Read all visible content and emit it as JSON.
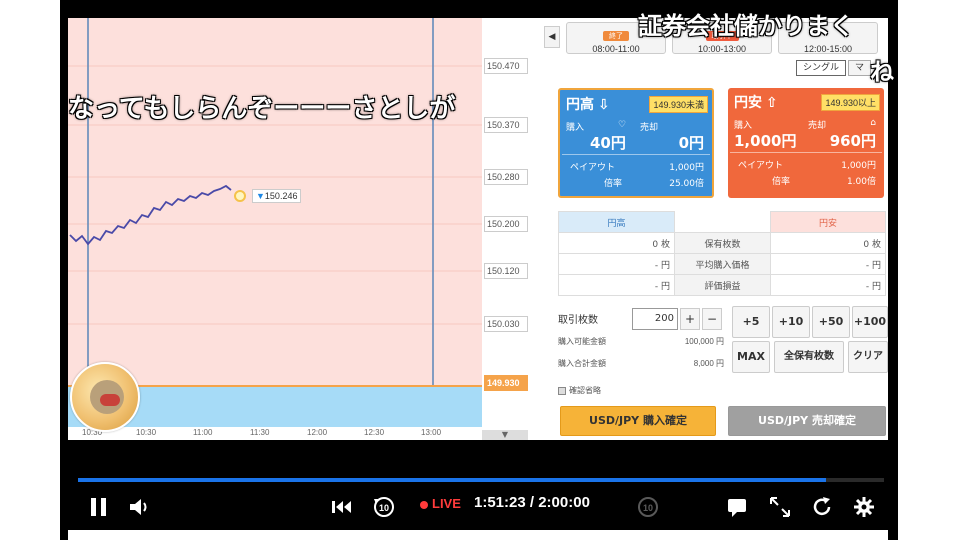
{
  "chart": {
    "y_ticks": [
      "150.470",
      "150.370",
      "150.280",
      "150.200",
      "150.120",
      "150.030"
    ],
    "current_price": "149.930",
    "price_tag": "150.246",
    "x_ticks": [
      "10:30",
      "10:30",
      "11:00",
      "11:30",
      "12:00",
      "12:30",
      "13:00"
    ],
    "line_color": "#4a4aa8",
    "zone_color_up": "#fde0dc",
    "zone_color_down": "#a6dbf7"
  },
  "panel": {
    "nav_arrow": "◀",
    "time_tabs": [
      {
        "badge": "終了",
        "range": "08:00-11:00"
      },
      {
        "badge": "取引中",
        "range": "10:00-13:00"
      },
      {
        "badge": "",
        "range": "12:00-15:00"
      }
    ],
    "modes": [
      "シングル",
      "マ"
    ],
    "up_card": {
      "title": "円高",
      "strike": "149.930未満",
      "buy_label": "購入",
      "sell_label": "売却",
      "buy_price": "40円",
      "sell_price": "0円",
      "payout_label": "ペイアウト",
      "payout_value": "1,000円",
      "rate_label": "倍率",
      "rate_value": "25.00倍"
    },
    "down_card": {
      "title": "円安",
      "strike": "149.930以上",
      "buy_label": "購入",
      "sell_label": "売却",
      "buy_price": "1,000円",
      "sell_price": "960円",
      "payout_label": "ペイアウト",
      "payout_value": "1,000円",
      "rate_label": "倍率",
      "rate_value": "1.00倍"
    },
    "positions": {
      "header_up": "円高",
      "header_down": "円安",
      "rows": [
        {
          "up": "0 枚",
          "label": "保有枚数",
          "down": "0 枚"
        },
        {
          "up": "- 円",
          "label": "平均購入価格",
          "down": "- 円"
        },
        {
          "up": "- 円",
          "label": "評価損益",
          "down": "- 円"
        }
      ]
    },
    "qty_label": "取引枚数",
    "qty_value": "200",
    "plus": "+",
    "minus": "−",
    "available_label": "購入可能金額",
    "available_value": "100,000 円",
    "total_label": "購入合計金額",
    "total_value": "8,000 円",
    "quick": [
      "+5",
      "+10",
      "+50",
      "+100",
      "MAX",
      "全保有枚数",
      "クリア"
    ],
    "confirm_label": "確認省略",
    "buy_confirm": "USD/JPY 購入確定",
    "sell_confirm": "USD/JPY 売却確定"
  },
  "comments": {
    "top_right": "証券会社儲かりまく",
    "top_right2": "ね",
    "middle": "なってもしらんぞーーーさとしが"
  },
  "player": {
    "live_label": "LIVE",
    "time": "1:51:23 / 2:00:00",
    "progress_fraction": 0.928,
    "accent": "#1a73e8"
  }
}
